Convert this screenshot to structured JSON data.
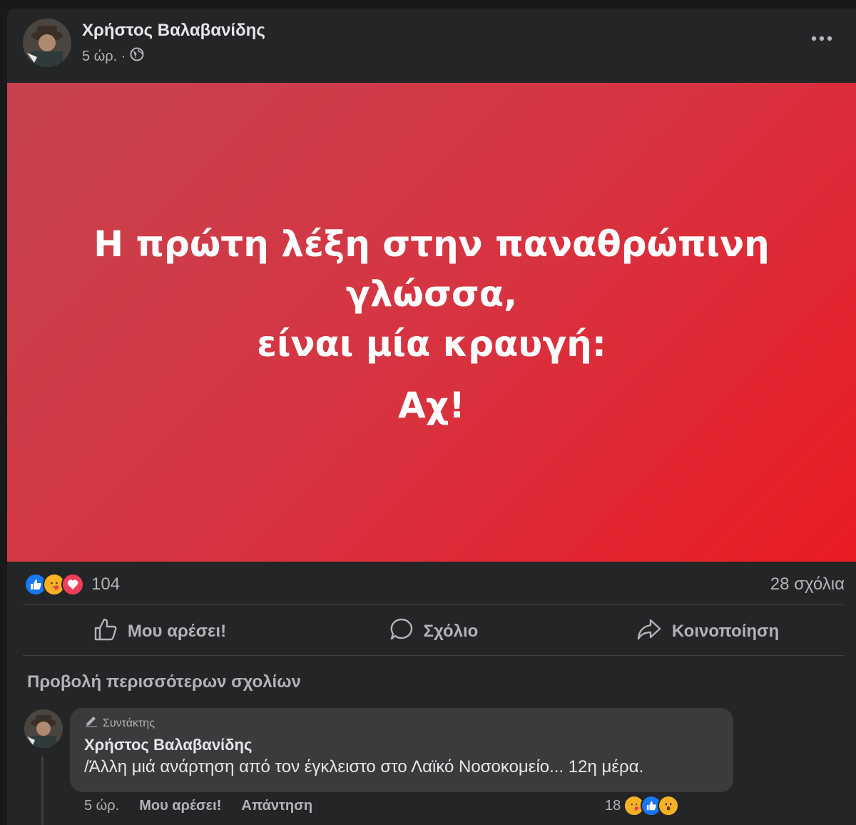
{
  "post": {
    "author": "Χρήστος Βαλαβανίδης",
    "time": "5 ώρ. ·",
    "privacy_icon": "globe-icon",
    "more_icon": "ellipsis-icon",
    "banner": {
      "line1": "Η πρώτη λέξη στην παναθρώπινη",
      "line2": "γλώσσα,",
      "line3": "είναι μία κραυγή:",
      "line4": "Αχ!",
      "gradient_start": "#c7434f",
      "gradient_end": "#ea1c24"
    },
    "reactions": {
      "types": [
        "like",
        "care",
        "love"
      ],
      "count": "104"
    },
    "comments_count": "28 σχόλια",
    "actions": {
      "like": "Μου αρέσει!",
      "comment": "Σχόλιο",
      "share": "Κοινοποίηση"
    },
    "more_comments": "Προβολή περισσότερων σχολίων"
  },
  "comment": {
    "badge": "Συντάκτης",
    "author": "Χρήστος Βαλαβανίδης",
    "text": "/Άλλη μιά ανάρτηση από τον έγκλειστο στο Λαϊκό Νοσοκομείο... 12η μέρα.",
    "time": "5 ώρ.",
    "like": "Μου αρέσει!",
    "reply": "Απάντηση",
    "reactions_count": "18",
    "reaction_types": [
      "care",
      "like",
      "wow"
    ]
  },
  "colors": {
    "like_blue": "#1877f2",
    "love_red": "#f33e58",
    "care_yellow": "#f7b125",
    "background": "#242526"
  }
}
